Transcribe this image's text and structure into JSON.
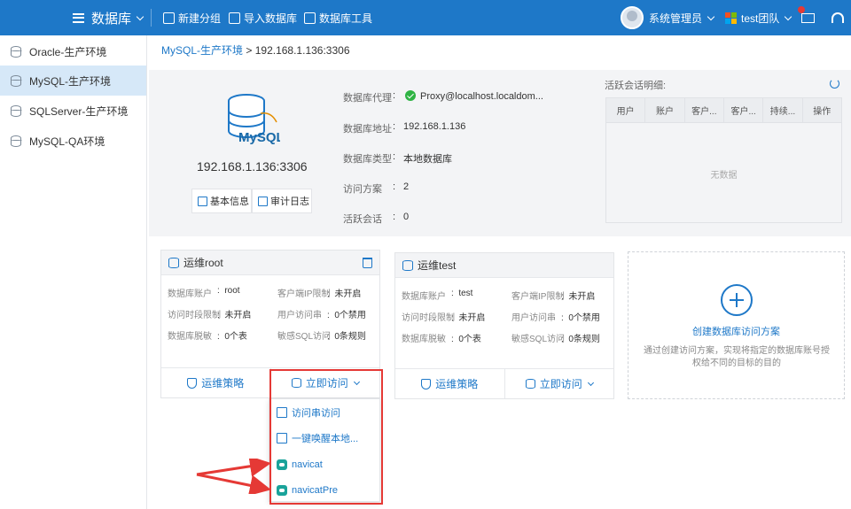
{
  "topbar": {
    "app_title": "数据库",
    "actions": [
      {
        "label": "新建分组",
        "icon": "add-group-icon"
      },
      {
        "label": "导入数据库",
        "icon": "import-icon"
      },
      {
        "label": "数据库工具",
        "icon": "tools-icon"
      }
    ],
    "user": "系统管理员",
    "team": "test团队",
    "brand_color": "#1e78c8"
  },
  "sidebar": {
    "items": [
      {
        "label": "Oracle-生产环境",
        "active": false
      },
      {
        "label": "MySQL-生产环境",
        "active": true
      },
      {
        "label": "SQLServer-生产环境",
        "active": false
      },
      {
        "label": "MySQL-QA环境",
        "active": false
      }
    ]
  },
  "breadcrumb": {
    "parent": "MySQL-生产环境",
    "separator": ">",
    "current": "192.168.1.136:3306"
  },
  "db_info": {
    "logo_text": "MySQL",
    "host": "192.168.1.136:3306",
    "basic_info_label": "基本信息",
    "audit_log_label": "审计日志",
    "fields": [
      {
        "label": "数据库代理",
        "value": "Proxy@localhost.localdom..."
      },
      {
        "label": "数据库地址",
        "value": "192.168.1.136"
      },
      {
        "label": "数据库类型",
        "value": "本地数据库"
      },
      {
        "label": "访问方案",
        "value": "2"
      },
      {
        "label": "活跃会话",
        "value": "0"
      }
    ],
    "separator": ":"
  },
  "sessions": {
    "title": "活跃会话明细:",
    "columns": [
      "用户",
      "账户",
      "客户...",
      "客户...",
      "持续...",
      "操作"
    ],
    "empty_text": "无数据"
  },
  "cards": [
    {
      "title": "运维root",
      "fields": [
        {
          "label": "数据库账户",
          "value": "root"
        },
        {
          "label": "客户端IP限制",
          "value": "未开启"
        },
        {
          "label": "访问时段限制",
          "value": "未开启"
        },
        {
          "label": "用户访问串",
          "value": "0个禁用"
        },
        {
          "label": "数据库脱敏",
          "value": "0个表"
        },
        {
          "label": "敏感SQL访问",
          "value": "0条规则"
        }
      ],
      "policy_label": "运维策略",
      "access_label": "立即访问"
    },
    {
      "title": "运维test",
      "fields": [
        {
          "label": "数据库账户",
          "value": "test"
        },
        {
          "label": "客户端IP限制",
          "value": "未开启"
        },
        {
          "label": "访问时段限制",
          "value": "未开启"
        },
        {
          "label": "用户访问串",
          "value": "0个禁用"
        },
        {
          "label": "数据库脱敏",
          "value": "0个表"
        },
        {
          "label": "敏感SQL访问",
          "value": "0条规则"
        }
      ],
      "policy_label": "运维策略",
      "access_label": "立即访问"
    }
  ],
  "new_scheme": {
    "title": "创建数据库访问方案",
    "description": "通过创建访问方案，实现将指定的数据库账号授权给不同的目标的目的"
  },
  "dropdown": {
    "items": [
      {
        "label": "访问串访问",
        "icon": "file-icon"
      },
      {
        "label": "一键唤醒本地...",
        "icon": "launch-icon"
      },
      {
        "label": "navicat",
        "icon": "navicat-icon"
      },
      {
        "label": "navicatPre",
        "icon": "navicat-icon"
      }
    ]
  },
  "annotation_color": "#e53935"
}
